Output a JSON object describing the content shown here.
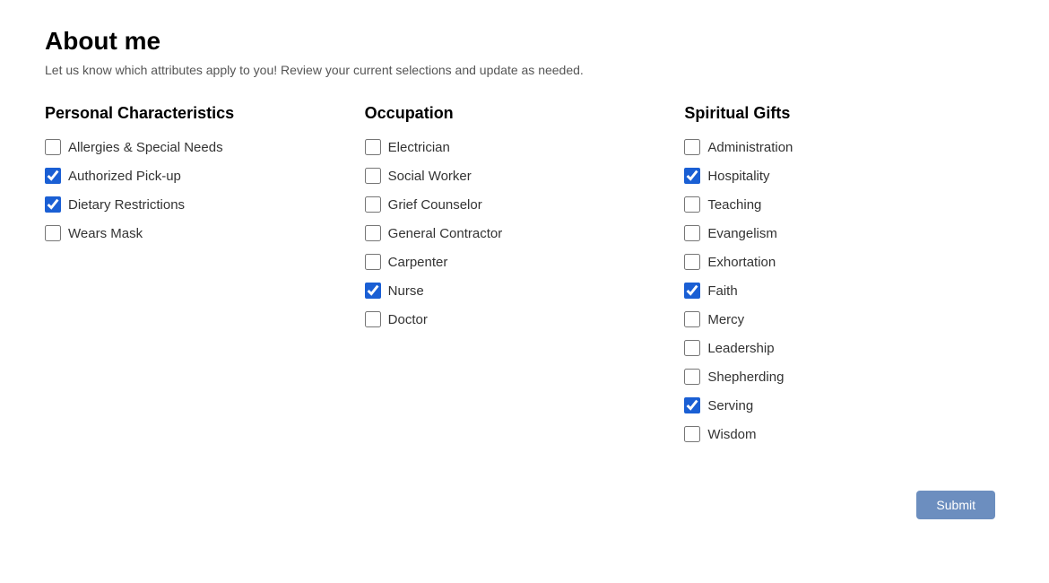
{
  "page": {
    "title": "About me",
    "subtitle": "Let us know which attributes apply to you! Review your current selections and update as needed."
  },
  "columns": [
    {
      "id": "personal",
      "header": "Personal Characteristics",
      "items": [
        {
          "id": "allergies",
          "label": "Allergies & Special Needs",
          "checked": false
        },
        {
          "id": "authorized-pickup",
          "label": "Authorized Pick-up",
          "checked": true
        },
        {
          "id": "dietary-restrictions",
          "label": "Dietary Restrictions",
          "checked": true
        },
        {
          "id": "wears-mask",
          "label": "Wears Mask",
          "checked": false
        }
      ]
    },
    {
      "id": "occupation",
      "header": "Occupation",
      "items": [
        {
          "id": "electrician",
          "label": "Electrician",
          "checked": false
        },
        {
          "id": "social-worker",
          "label": "Social Worker",
          "checked": false
        },
        {
          "id": "grief-counselor",
          "label": "Grief Counselor",
          "checked": false
        },
        {
          "id": "general-contractor",
          "label": "General Contractor",
          "checked": false
        },
        {
          "id": "carpenter",
          "label": "Carpenter",
          "checked": false
        },
        {
          "id": "nurse",
          "label": "Nurse",
          "checked": true
        },
        {
          "id": "doctor",
          "label": "Doctor",
          "checked": false
        }
      ]
    },
    {
      "id": "spiritual",
      "header": "Spiritual Gifts",
      "items": [
        {
          "id": "administration",
          "label": "Administration",
          "checked": false
        },
        {
          "id": "hospitality",
          "label": "Hospitality",
          "checked": true
        },
        {
          "id": "teaching",
          "label": "Teaching",
          "checked": false
        },
        {
          "id": "evangelism",
          "label": "Evangelism",
          "checked": false
        },
        {
          "id": "exhortation",
          "label": "Exhortation",
          "checked": false
        },
        {
          "id": "faith",
          "label": "Faith",
          "checked": true
        },
        {
          "id": "mercy",
          "label": "Mercy",
          "checked": false
        },
        {
          "id": "leadership",
          "label": "Leadership",
          "checked": false
        },
        {
          "id": "shepherding",
          "label": "Shepherding",
          "checked": false
        },
        {
          "id": "serving",
          "label": "Serving",
          "checked": true
        },
        {
          "id": "wisdom",
          "label": "Wisdom",
          "checked": false
        }
      ]
    }
  ],
  "submit": {
    "label": "Submit"
  }
}
